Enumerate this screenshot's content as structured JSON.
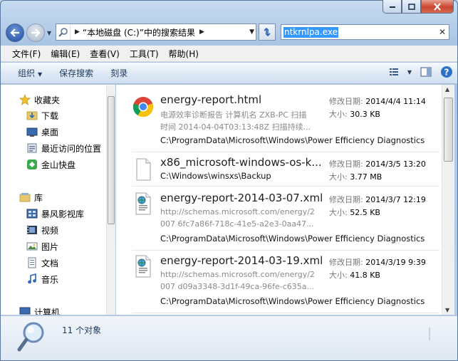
{
  "address": {
    "location": "“本地磁盘 (C:)”中的搜索结果"
  },
  "search": {
    "value": "ntkrnlpa.exe"
  },
  "menubar": {
    "items": [
      "文件(F)",
      "编辑(E)",
      "查看(V)",
      "工具(T)",
      "帮助(H)"
    ]
  },
  "toolbar": {
    "organize": "组织",
    "save_search": "保存搜索",
    "burn": "刻录"
  },
  "sidebar": {
    "favorites_label": "收藏夹",
    "favorites": [
      "下载",
      "桌面",
      "最近访问的位置",
      "金山快盘"
    ],
    "libraries_label": "库",
    "libraries": [
      "暴风影视库",
      "视频",
      "图片",
      "文档",
      "音乐"
    ],
    "computer_label": "计算机"
  },
  "results": [
    {
      "name": "energy-report.html",
      "date_label": "修改日期:",
      "date": "2014/4/4 11:14",
      "size_label": "大小:",
      "size": "30.3 KB",
      "desc1": "电源效率诊断报告 计算机名 ZXB-PC 扫描",
      "desc2": "时间 2014-04-04T03:13:48Z 扫描持续...",
      "path": "C:\\ProgramData\\Microsoft\\Windows\\Power Efficiency Diagnostics",
      "icon": "chrome-icon"
    },
    {
      "name": "x86_microsoft-windows-os-k...",
      "date_label": "修改日期:",
      "date": "2014/3/5 13:20",
      "size_label": "大小:",
      "size": "3.77 MB",
      "path": "C:\\Windows\\winsxs\\Backup",
      "icon": "file-icon"
    },
    {
      "name": "energy-report-2014-03-07.xml",
      "date_label": "修改日期:",
      "date": "2014/3/7 12:19",
      "size_label": "大小:",
      "size": "52.5 KB",
      "desc1": "http://schemas.microsoft.com/energy/2",
      "desc2": "007 6fc7a86f-718c-41e5-a2e3-0aa47...",
      "path": "C:\\ProgramData\\Microsoft\\Windows\\Power Efficiency Diagnostics",
      "icon": "xml-file-icon"
    },
    {
      "name": "energy-report-2014-03-19.xml",
      "date_label": "修改日期:",
      "date": "2014/3/19 9:39",
      "size_label": "大小:",
      "size": "41.8 KB",
      "desc1": "http://schemas.microsoft.com/energy/2",
      "desc2": "007 d09a3348-3d1f-49ca-96fe-c635a...",
      "path": "C:\\ProgramData\\Microsoft\\Windows\\Power Efficiency Diagnostics",
      "icon": "xml-file-icon"
    }
  ],
  "details": {
    "count": "11 个对象"
  }
}
